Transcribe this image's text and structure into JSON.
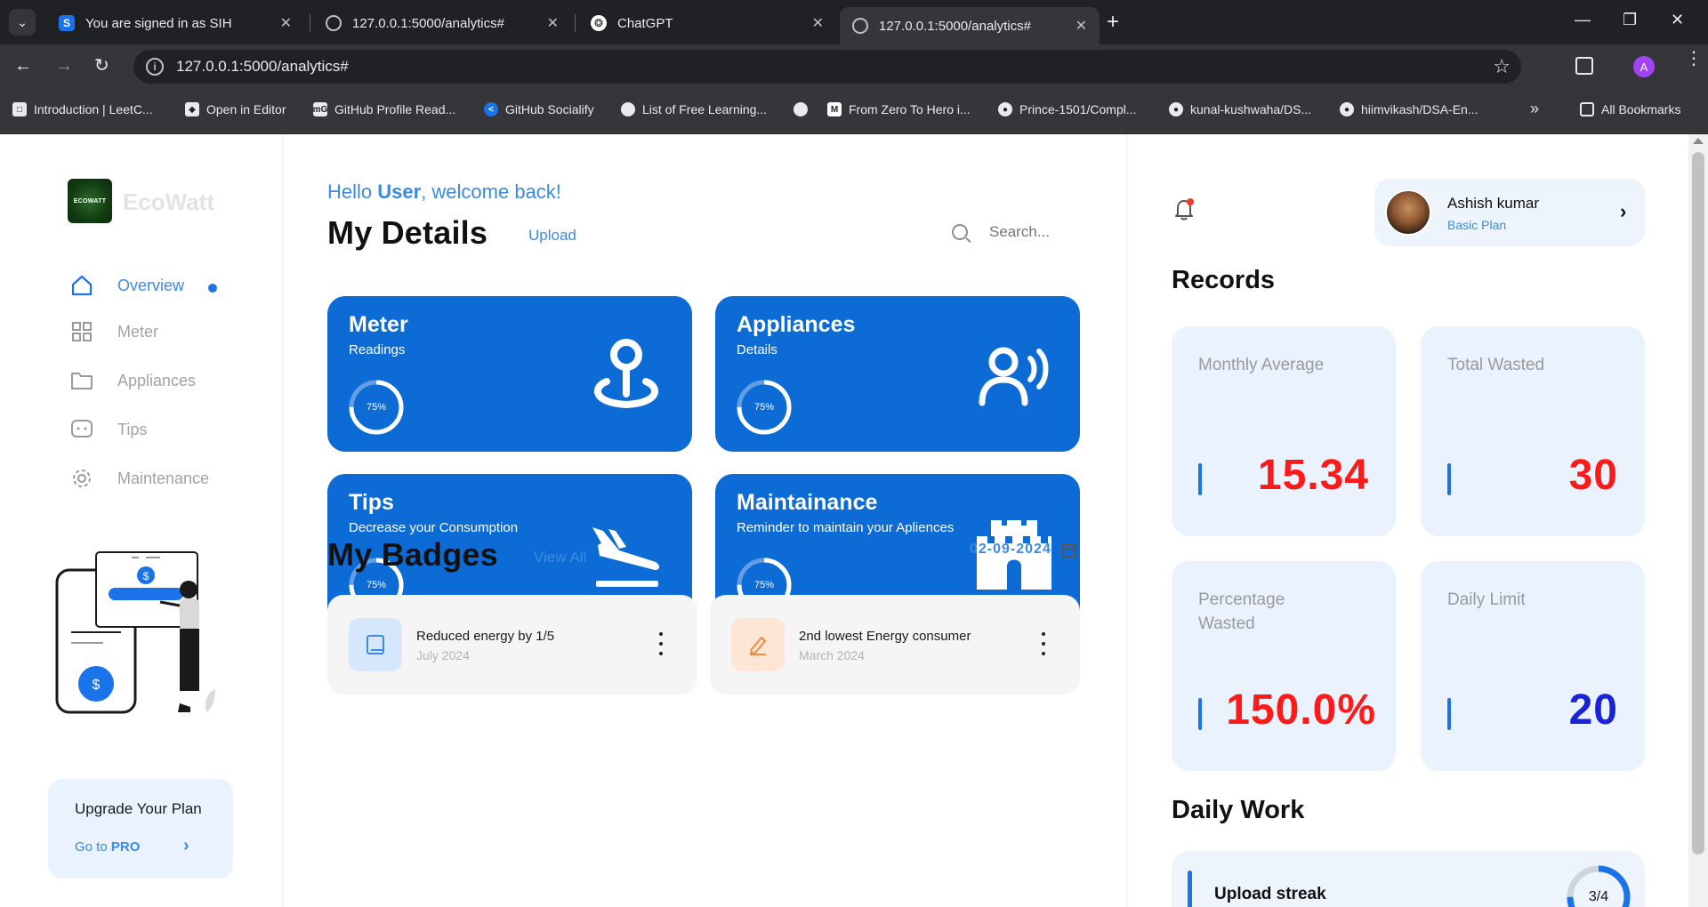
{
  "browser": {
    "tabs": [
      {
        "title": "You are signed in as SIH",
        "favicon": "S"
      },
      {
        "title": "127.0.0.1:5000/analytics#",
        "favicon": "globe"
      },
      {
        "title": "ChatGPT",
        "favicon": "chatgpt"
      },
      {
        "title": "127.0.0.1:5000/analytics#",
        "favicon": "globe"
      }
    ],
    "url": "127.0.0.1:5000/analytics#",
    "profile_initial": "A",
    "bookmarks": [
      {
        "label": "Introduction | LeetC..."
      },
      {
        "label": "Open in Editor"
      },
      {
        "label": "GitHub Profile Read..."
      },
      {
        "label": "GitHub Socialify"
      },
      {
        "label": "List of Free Learning..."
      },
      {
        "label": "From Zero To Hero i..."
      },
      {
        "label": "Prince-1501/Compl..."
      },
      {
        "label": "kunal-kushwaha/DS..."
      },
      {
        "label": "hiimvikash/DSA-En..."
      }
    ],
    "bookmarks_more": "»",
    "all_bookmarks": "All Bookmarks"
  },
  "sidebar": {
    "brand": "EcoWatt",
    "logo_text": "ECOWATT",
    "nav": [
      {
        "label": "Overview",
        "icon": "home-icon"
      },
      {
        "label": "Meter",
        "icon": "grid-icon"
      },
      {
        "label": "Appliances",
        "icon": "folder-icon"
      },
      {
        "label": "Tips",
        "icon": "chat-icon"
      },
      {
        "label": "Maintenance",
        "icon": "gear-icon"
      }
    ],
    "illustration_currency": "$",
    "upgrade": {
      "title": "Upgrade Your Plan",
      "link_prefix": "Go to",
      "link_strong": "PRO"
    }
  },
  "main": {
    "greeting_prefix": "Hello",
    "greeting_user": "User",
    "greeting_suffix": ", welcome back!",
    "details_title": "My Details",
    "upload_link": "Upload",
    "search_placeholder": "Search...",
    "cards": [
      {
        "title": "Meter",
        "subtitle": "Readings",
        "percent": 75,
        "percent_label": "75%",
        "icon": "map-pin-icon"
      },
      {
        "title": "Appliances",
        "subtitle": "Details",
        "percent": 75,
        "percent_label": "75%",
        "icon": "voice-user-icon"
      },
      {
        "title": "Tips",
        "subtitle": "Decrease your Consumption",
        "percent": 75,
        "percent_label": "75%",
        "icon": "plane-landing-icon"
      },
      {
        "title": "Maintainance",
        "subtitle": "Reminder to maintain your Apliences",
        "percent": 75,
        "percent_label": "75%",
        "icon": "castle-icon"
      }
    ],
    "badges_title": "My Badges",
    "view_all": "View All",
    "date": "02-09-2024",
    "badges": [
      {
        "title": "Reduced energy by 1/5",
        "date": "July 2024",
        "icon": "book-icon",
        "color": "#d6e6fb",
        "icon_color": "#3d8be0"
      },
      {
        "title": "2nd lowest Energy consumer",
        "date": "March 2024",
        "icon": "pencil-icon",
        "color": "#fde6d6",
        "icon_color": "#f08a3c"
      }
    ]
  },
  "right": {
    "user": {
      "name": "Ashish kumar",
      "plan": "Basic Plan"
    },
    "records_title": "Records",
    "stats": [
      {
        "label": "Monthly Average",
        "value": "15.34",
        "color": "#ff1a1a"
      },
      {
        "label": "Total Wasted",
        "value": "30",
        "color": "#ff1a1a"
      },
      {
        "label": "Percentage Wasted",
        "value": "150.0%",
        "color": "#ff1a1a"
      },
      {
        "label": "Daily Limit",
        "value": "20",
        "color": "#1a24d6"
      }
    ],
    "daily_work_title": "Daily Work",
    "daily_work": {
      "label": "Upload streak",
      "value": "3/4",
      "progress": 0.75
    }
  },
  "colors": {
    "accent": "#0d6bd6",
    "link": "#3d8be0",
    "stat_bg": "#e9f2fd",
    "danger": "#ff1a1a"
  }
}
